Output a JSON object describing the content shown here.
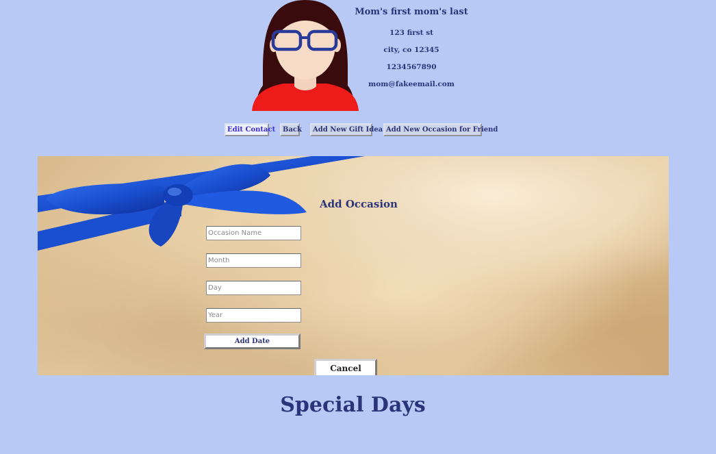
{
  "contact": {
    "name": "Mom's first mom's last",
    "address": "123 first st",
    "city_line": "city, co 12345",
    "phone": "1234567890",
    "email": "mom@fakeemail.com"
  },
  "nav": {
    "edit_contact": "Edit Contact",
    "back": "Back",
    "add_gift_idea": "Add New Gift Idea",
    "add_occasion": "Add New Occasion for Friend"
  },
  "form": {
    "title": "Add Occasion",
    "occasion_placeholder": "Occasion Name",
    "month_placeholder": "Month",
    "day_placeholder": "Day",
    "year_placeholder": "Year",
    "add_date_label": "Add Date",
    "cancel_label": "Cancel"
  },
  "section": {
    "title": "Special Days"
  },
  "colors": {
    "background": "#b8c9f6",
    "text": "#2a3478",
    "ribbon": "#1a4fd0"
  }
}
